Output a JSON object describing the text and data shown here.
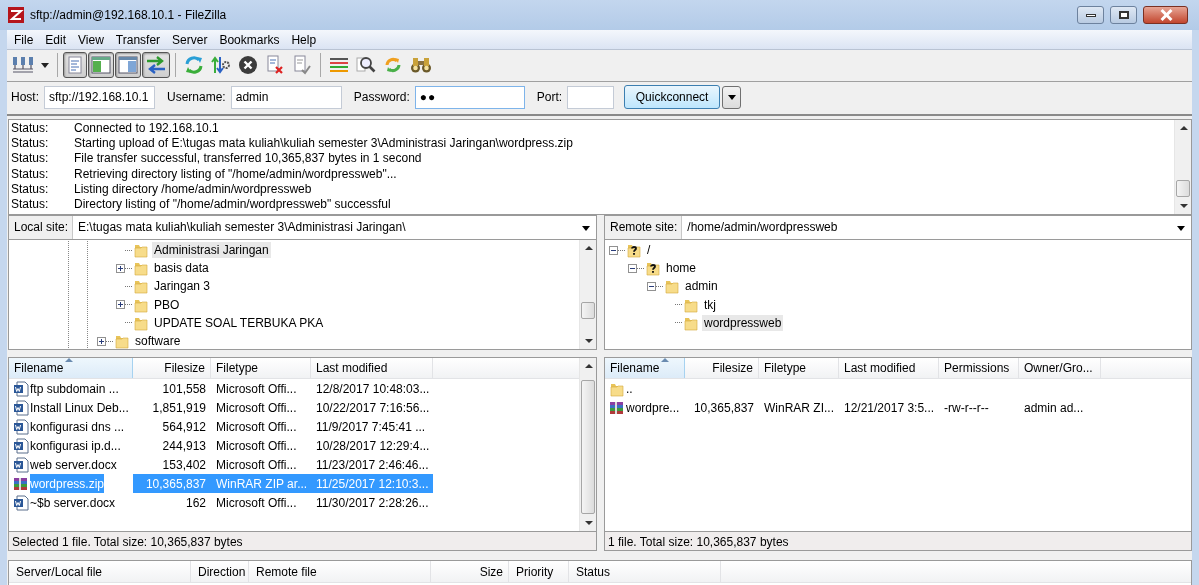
{
  "window": {
    "title": "sftp://admin@192.168.10.1 - FileZilla"
  },
  "menu": [
    "File",
    "Edit",
    "View",
    "Transfer",
    "Server",
    "Bookmarks",
    "Help"
  ],
  "toolbar": [
    {
      "kind": "site-manager",
      "pressed": false
    },
    {
      "kind": "dropdown",
      "pressed": false
    },
    {
      "kind": "separator"
    },
    {
      "kind": "toggle-log",
      "pressed": true
    },
    {
      "kind": "toggle-local-tree",
      "pressed": true
    },
    {
      "kind": "toggle-remote-tree",
      "pressed": true
    },
    {
      "kind": "toggle-queue",
      "pressed": true
    },
    {
      "kind": "separator"
    },
    {
      "kind": "refresh",
      "pressed": false
    },
    {
      "kind": "process-queue",
      "pressed": false
    },
    {
      "kind": "cancel",
      "pressed": false
    },
    {
      "kind": "disconnect",
      "pressed": false
    },
    {
      "kind": "reconnect",
      "pressed": false
    },
    {
      "kind": "separator"
    },
    {
      "kind": "filter",
      "pressed": false
    },
    {
      "kind": "compare",
      "pressed": false
    },
    {
      "kind": "sync",
      "pressed": false
    },
    {
      "kind": "search",
      "pressed": false
    }
  ],
  "quickconnect": {
    "host_label": "Host:",
    "host": "sftp://192.168.10.1",
    "username_label": "Username:",
    "username": "admin",
    "password_label": "Password:",
    "password": "●●",
    "port_label": "Port:",
    "button": "Quickconnect"
  },
  "log": [
    {
      "label": "Status:",
      "message": "Connected to 192.168.10.1"
    },
    {
      "label": "Status:",
      "message": "Starting upload of E:\\tugas mata kuliah\\kuliah semester 3\\Administrasi Jaringan\\wordpress.zip"
    },
    {
      "label": "Status:",
      "message": "File transfer successful, transferred 10,365,837 bytes in 1 second"
    },
    {
      "label": "Status:",
      "message": "Retrieving directory listing of \"/home/admin/wordpressweb\"..."
    },
    {
      "label": "Status:",
      "message": "Listing directory /home/admin/wordpressweb"
    },
    {
      "label": "Status:",
      "message": "Directory listing of \"/home/admin/wordpressweb\" successful"
    }
  ],
  "local": {
    "site_label": "Local site:",
    "path": "E:\\tugas mata kuliah\\kuliah semester 3\\Administrasi Jaringan\\",
    "tree": {
      "scrollable": true,
      "nodes": [
        {
          "children": [
            {
              "label": "Administrasi Jaringan",
              "kind": "folder",
              "has_toggle": false,
              "selected": true
            },
            {
              "label": "basis data",
              "kind": "folder",
              "has_toggle": true,
              "expanded": false,
              "selected": false
            },
            {
              "label": "Jaringan 3",
              "kind": "folder",
              "has_toggle": false,
              "selected": false
            },
            {
              "label": "PBO",
              "kind": "folder",
              "has_toggle": true,
              "expanded": false,
              "selected": false
            },
            {
              "label": "UPDATE SOAL TERBUKA PKA",
              "kind": "folder",
              "has_toggle": false,
              "selected": false
            }
          ]
        },
        {
          "label": "software",
          "kind": "folder",
          "has_toggle": true,
          "expanded": false,
          "selected": false
        }
      ]
    },
    "files": {
      "scrollable": true,
      "columns": [
        {
          "label": "Filename",
          "sorted": true
        },
        {
          "label": "Filesize",
          "sorted": false
        },
        {
          "label": "Filetype",
          "sorted": false
        },
        {
          "label": "Last modified",
          "sorted": false
        }
      ],
      "rows": [
        {
          "kind": "word",
          "cells": [
            "ftp subdomain ...",
            "101,558",
            "Microsoft Offi...",
            "12/8/2017 10:48:03..."
          ],
          "selected": false
        },
        {
          "kind": "word",
          "cells": [
            "Install Linux Deb...",
            "1,851,919",
            "Microsoft Offi...",
            "10/22/2017 7:16:56..."
          ],
          "selected": false
        },
        {
          "kind": "word",
          "cells": [
            "konfigurasi dns ...",
            "564,912",
            "Microsoft Offi...",
            "11/9/2017 7:45:41 ..."
          ],
          "selected": false
        },
        {
          "kind": "word",
          "cells": [
            "konfigurasi ip.d...",
            "244,913",
            "Microsoft Offi...",
            "10/28/2017 12:29:4..."
          ],
          "selected": false
        },
        {
          "kind": "word",
          "cells": [
            "web server.docx",
            "153,402",
            "Microsoft Offi...",
            "11/23/2017 2:46:46..."
          ],
          "selected": false
        },
        {
          "kind": "archive",
          "cells": [
            "wordpress.zip",
            "10,365,837",
            "WinRAR ZIP ar...",
            "11/25/2017 12:10:3..."
          ],
          "selected": true
        },
        {
          "kind": "word",
          "cells": [
            "~$b server.docx",
            "162",
            "Microsoft Offi...",
            "11/30/2017 2:28:26..."
          ],
          "selected": false
        }
      ]
    },
    "status": "Selected 1 file. Total size: 10,365,837 bytes"
  },
  "remote": {
    "site_label": "Remote site:",
    "path": "/home/admin/wordpressweb",
    "tree": {
      "scrollable": false,
      "nodes": [
        {
          "label": "/",
          "kind": "unknown",
          "has_toggle": true,
          "expanded": true,
          "selected": false,
          "children": [
            {
              "label": "home",
              "kind": "unknown",
              "has_toggle": true,
              "expanded": true,
              "selected": false,
              "children": [
                {
                  "label": "admin",
                  "kind": "folder",
                  "has_toggle": true,
                  "expanded": true,
                  "selected": false,
                  "children": [
                    {
                      "label": "tkj",
                      "kind": "folder",
                      "has_toggle": false,
                      "selected": false
                    },
                    {
                      "label": "wordpressweb",
                      "kind": "folder",
                      "has_toggle": false,
                      "selected": true
                    }
                  ]
                }
              ]
            }
          ]
        }
      ]
    },
    "files": {
      "scrollable": false,
      "columns": [
        {
          "label": "Filename",
          "sorted": true
        },
        {
          "label": "Filesize",
          "sorted": false
        },
        {
          "label": "Filetype",
          "sorted": false
        },
        {
          "label": "Last modified",
          "sorted": false
        },
        {
          "label": "Permissions",
          "sorted": false
        },
        {
          "label": "Owner/Gro...",
          "sorted": false
        }
      ],
      "rows": [
        {
          "kind": "folder",
          "cells": [
            ".."
          ],
          "selected": false
        },
        {
          "kind": "archive",
          "cells": [
            "wordpre...",
            "10,365,837",
            "WinRAR ZI...",
            "12/21/2017 3:5...",
            "-rw-r--r--",
            "admin ad..."
          ],
          "selected": false
        }
      ]
    },
    "status": "1 file. Total size: 10,365,837 bytes"
  },
  "queue": {
    "columns": [
      "Server/Local file",
      "Direction",
      "Remote file",
      "Size",
      "Priority",
      "Status"
    ]
  }
}
